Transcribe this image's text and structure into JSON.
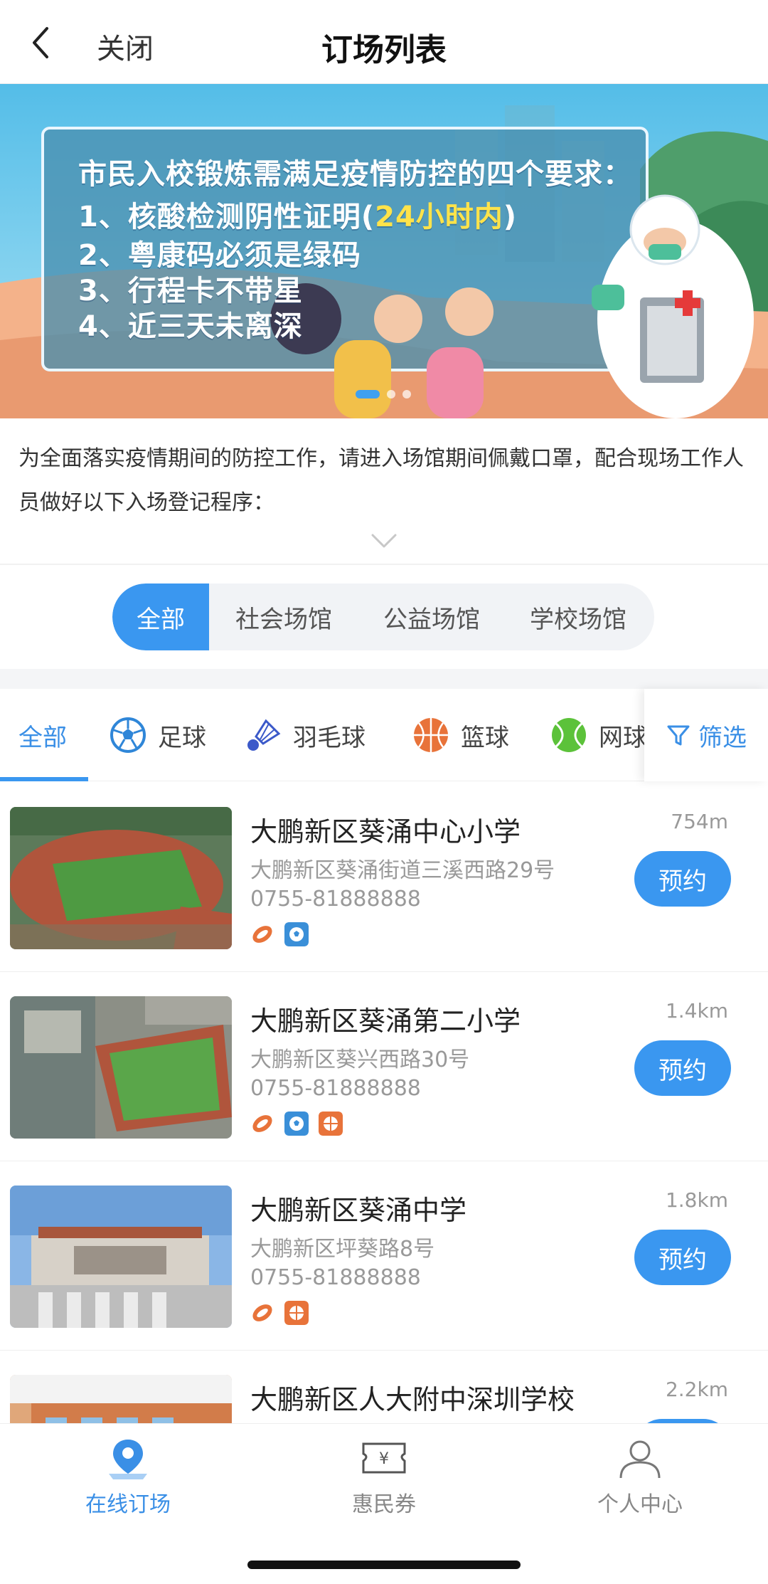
{
  "header": {
    "close_label": "关闭",
    "title": "订场列表"
  },
  "banner": {
    "heading": "市民入校锻炼需满足疫情防控的四个要求：",
    "line1_a": "1、核酸检测阴性证明(",
    "line1_highlight": "24小时内",
    "line1_b": ")",
    "line2": "2、粤康码必须是绿码",
    "line3": "3、行程卡不带星",
    "line4": "4、近三天未离深",
    "carousel_current": 1,
    "carousel_total": 3
  },
  "notice": {
    "text": "为全面落实疫情期间的防控工作，请进入场馆期间佩戴口罩，配合现场工作人员做好以下入场登记程序："
  },
  "venue_types": {
    "items": [
      "全部",
      "社会场馆",
      "公益场馆",
      "学校场馆"
    ],
    "selected": "全部"
  },
  "sports": {
    "items": [
      {
        "label": "全部",
        "icon": ""
      },
      {
        "label": "足球",
        "icon": "soccer-icon"
      },
      {
        "label": "羽毛球",
        "icon": "shuttlecock-icon"
      },
      {
        "label": "篮球",
        "icon": "basketball-icon"
      },
      {
        "label": "网球",
        "icon": "tennis-icon"
      }
    ],
    "selected": "全部",
    "filter_label": "筛选"
  },
  "venues": [
    {
      "name": "大鹏新区葵涌中心小学",
      "address": "大鹏新区葵涌街道三溪西路29号",
      "phone": "0755-81888888",
      "distance": "754m",
      "tags": [
        "track-icon",
        "soccer-icon"
      ]
    },
    {
      "name": "大鹏新区葵涌第二小学",
      "address": "大鹏新区葵兴西路30号",
      "phone": "0755-81888888",
      "distance": "1.4km",
      "tags": [
        "track-icon",
        "soccer-icon",
        "basketball-icon"
      ]
    },
    {
      "name": "大鹏新区葵涌中学",
      "address": "大鹏新区坪葵路8号",
      "phone": "0755-81888888",
      "distance": "1.8km",
      "tags": [
        "track-icon",
        "basketball-icon"
      ]
    },
    {
      "name": "大鹏新区人大附中深圳学校",
      "address": "",
      "phone": "",
      "distance": "2.2km",
      "tags": []
    }
  ],
  "book_label": "预约",
  "bottom_nav": {
    "items": [
      {
        "label": "在线订场",
        "icon": "location-pin-icon"
      },
      {
        "label": "惠民券",
        "icon": "coupon-icon"
      },
      {
        "label": "个人中心",
        "icon": "user-icon"
      }
    ],
    "selected": "在线订场"
  },
  "colors": {
    "accent": "#3a97f0",
    "highlight": "#ffe34a"
  }
}
